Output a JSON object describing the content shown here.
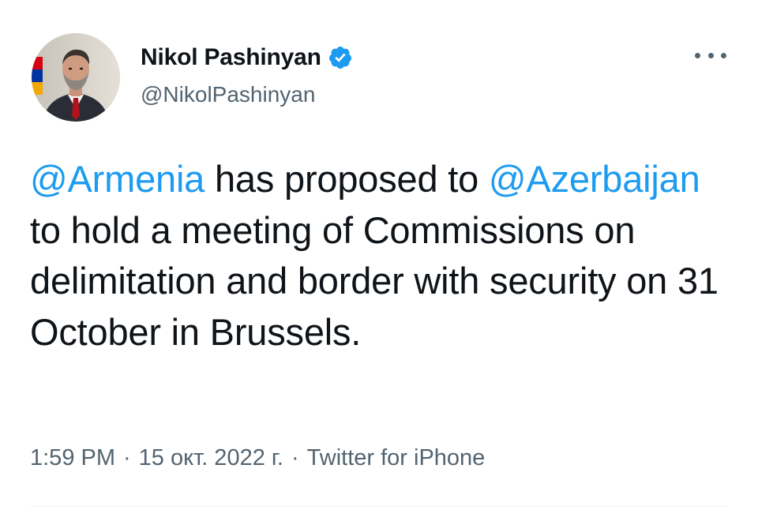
{
  "author": {
    "name": "Nikol Pashinyan",
    "handle": "@NikolPashinyan",
    "verified": true
  },
  "tweet": {
    "segments": [
      {
        "type": "mention",
        "text": "@Armenia"
      },
      {
        "type": "text",
        "text": " has proposed to "
      },
      {
        "type": "mention",
        "text": "@Azerbaijan"
      },
      {
        "type": "text",
        "text": " to hold a meeting of Commissions on delimitation and border with security on 31 October in Brussels."
      }
    ]
  },
  "meta": {
    "time": "1:59 PM",
    "separator": "·",
    "date": "15 окт. 2022 г.",
    "source": "Twitter for iPhone"
  },
  "icons": {
    "verified": "verified-badge-icon",
    "more": "more-dots-icon"
  },
  "colors": {
    "mention": "#1d9bf0",
    "text": "#0f1419",
    "secondary": "#536471",
    "divider": "#eff3f4"
  }
}
